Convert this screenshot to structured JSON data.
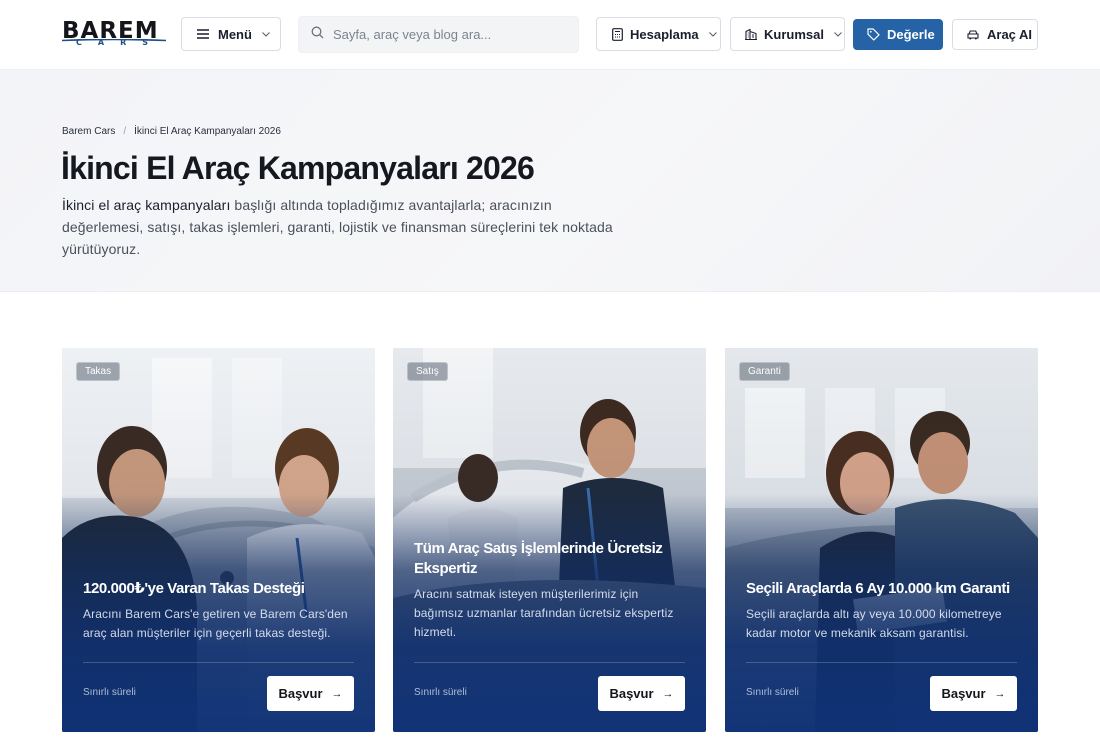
{
  "header": {
    "logo_text": "BAREM",
    "logo_sub": "CARS",
    "menu_label": "Menü",
    "search_placeholder": "Sayfa, araç veya blog ara...",
    "calc_label": "Hesaplama",
    "corp_label": "Kurumsal",
    "value_label": "Değerle",
    "ai_label": "Araç AI"
  },
  "breadcrumb": {
    "home": "Barem Cars",
    "separator": "/",
    "current": "İkinci El Araç Kampanyaları 2026"
  },
  "hero": {
    "title": "İkinci El Araç Kampanyaları 2026",
    "lead_strong": "İkinci el araç kampanyaları",
    "lead_rest": " başlığı altında topladığımız avantajlarla; aracınızın değerlemesi, satışı, takas işlemleri, garanti, lojistik ve finansman süreçlerini tek noktada yürütüyoruz."
  },
  "cards": [
    {
      "tag": "Takas",
      "title": "120.000₺'ye Varan Takas Desteği",
      "desc": "Aracını Barem Cars'e getiren ve Barem Cars'den araç alan müşteriler için geçerli takas desteği.",
      "limit": "Sınırlı süreli",
      "cta": "Başvur"
    },
    {
      "tag": "Satış",
      "title": "Tüm Araç Satış İşlemlerinde Ücretsiz Ekspertiz",
      "desc": "Aracını satmak isteyen müşterilerimiz için bağımsız uzmanlar tarafından ücretsiz ekspertiz hizmeti.",
      "limit": "Sınırlı süreli",
      "cta": "Başvur"
    },
    {
      "tag": "Garanti",
      "title": "Seçili Araçlarda 6 Ay 10.000 km Garanti",
      "desc": "Seçili araçlarda altı ay veya 10.000 kilometreye kadar motor ve mekanik aksam garantisi.",
      "limit": "Sınırlı süreli",
      "cta": "Başvur"
    }
  ],
  "colors": {
    "accent": "#2563a6",
    "card_overlay": "#10306e",
    "logo_blue": "#1e4f86"
  }
}
